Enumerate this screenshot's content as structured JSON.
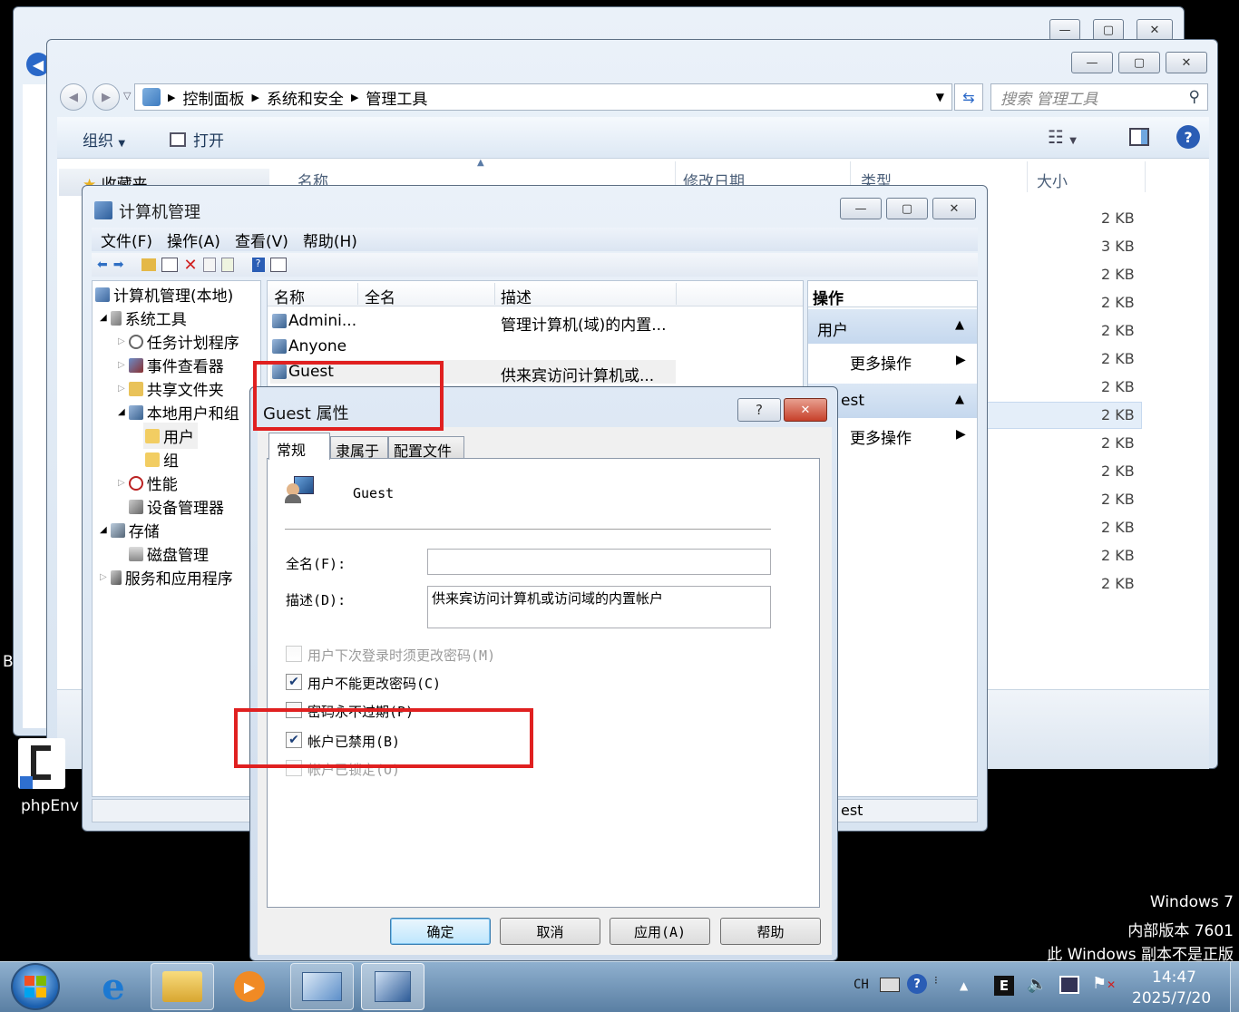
{
  "desktop": {
    "icon_label": "phpEnv",
    "left_letter": "B",
    "watermark": [
      "Windows 7",
      "内部版本 7601",
      "此 Windows 副本不是正版"
    ]
  },
  "explorer": {
    "breadcrumb": [
      "控制面板",
      "系统和安全",
      "管理工具"
    ],
    "search_placeholder": "搜索 管理工具",
    "toolbar": {
      "organize": "组织",
      "open": "打开"
    },
    "favorites": "收藏夹",
    "columns": [
      "名称",
      "修改日期",
      "类型",
      "大小"
    ],
    "sizes": [
      "2 KB",
      "3 KB",
      "2 KB",
      "2 KB",
      "2 KB",
      "2 KB",
      "2 KB",
      "2 KB",
      "2 KB",
      "2 KB",
      "2 KB",
      "2 KB",
      "2 KB",
      "2 KB"
    ]
  },
  "compmgmt": {
    "title": "计算机管理",
    "menu": [
      "文件(F)",
      "操作(A)",
      "查看(V)",
      "帮助(H)"
    ],
    "tree": {
      "root": "计算机管理(本地)",
      "system_tools": "系统工具",
      "task_scheduler": "任务计划程序",
      "event_viewer": "事件查看器",
      "shared_folders": "共享文件夹",
      "local_users": "本地用户和组",
      "users": "用户",
      "groups": "组",
      "performance": "性能",
      "device_manager": "设备管理器",
      "storage": "存储",
      "disk_management": "磁盘管理",
      "services_apps": "服务和应用程序"
    },
    "list_columns": [
      "名称",
      "全名",
      "描述"
    ],
    "users": [
      {
        "name": "Admini...",
        "fullname": "",
        "desc": "管理计算机(域)的内置..."
      },
      {
        "name": "Anyone",
        "fullname": "",
        "desc": ""
      },
      {
        "name": "Guest",
        "fullname": "",
        "desc": "供来宾访问计算机或..."
      }
    ],
    "actions": {
      "header": "操作",
      "section1": "用户",
      "more1": "更多操作",
      "section2_partial": "est",
      "more2": "更多操作",
      "status_partial": "est"
    }
  },
  "dialog": {
    "title": "Guest 属性",
    "tabs": [
      "常规",
      "隶属于",
      "配置文件"
    ],
    "username": "Guest",
    "fullname_label": "全名(F):",
    "fullname_value": "",
    "desc_label": "描述(D):",
    "desc_value": "供来宾访问计算机或访问域的内置帐户",
    "options": [
      {
        "label": "用户下次登录时须更改密码(M)",
        "checked": false,
        "disabled": true
      },
      {
        "label": "用户不能更改密码(C)",
        "checked": true,
        "disabled": false
      },
      {
        "label": "密码永不过期(P)",
        "checked": false,
        "disabled": false
      },
      {
        "label": "帐户已禁用(B)",
        "checked": true,
        "disabled": false
      },
      {
        "label": "帐户已锁定(O)",
        "checked": false,
        "disabled": true
      }
    ],
    "buttons": {
      "ok": "确定",
      "cancel": "取消",
      "apply": "应用(A)",
      "help": "帮助"
    }
  },
  "taskbar": {
    "lang": "CH",
    "time": "14:47",
    "date": "2025/7/20"
  },
  "colors": {
    "highlight_red": "#e02020",
    "selection": "#cce8ff",
    "accent_blue": "#1f5fb4"
  }
}
